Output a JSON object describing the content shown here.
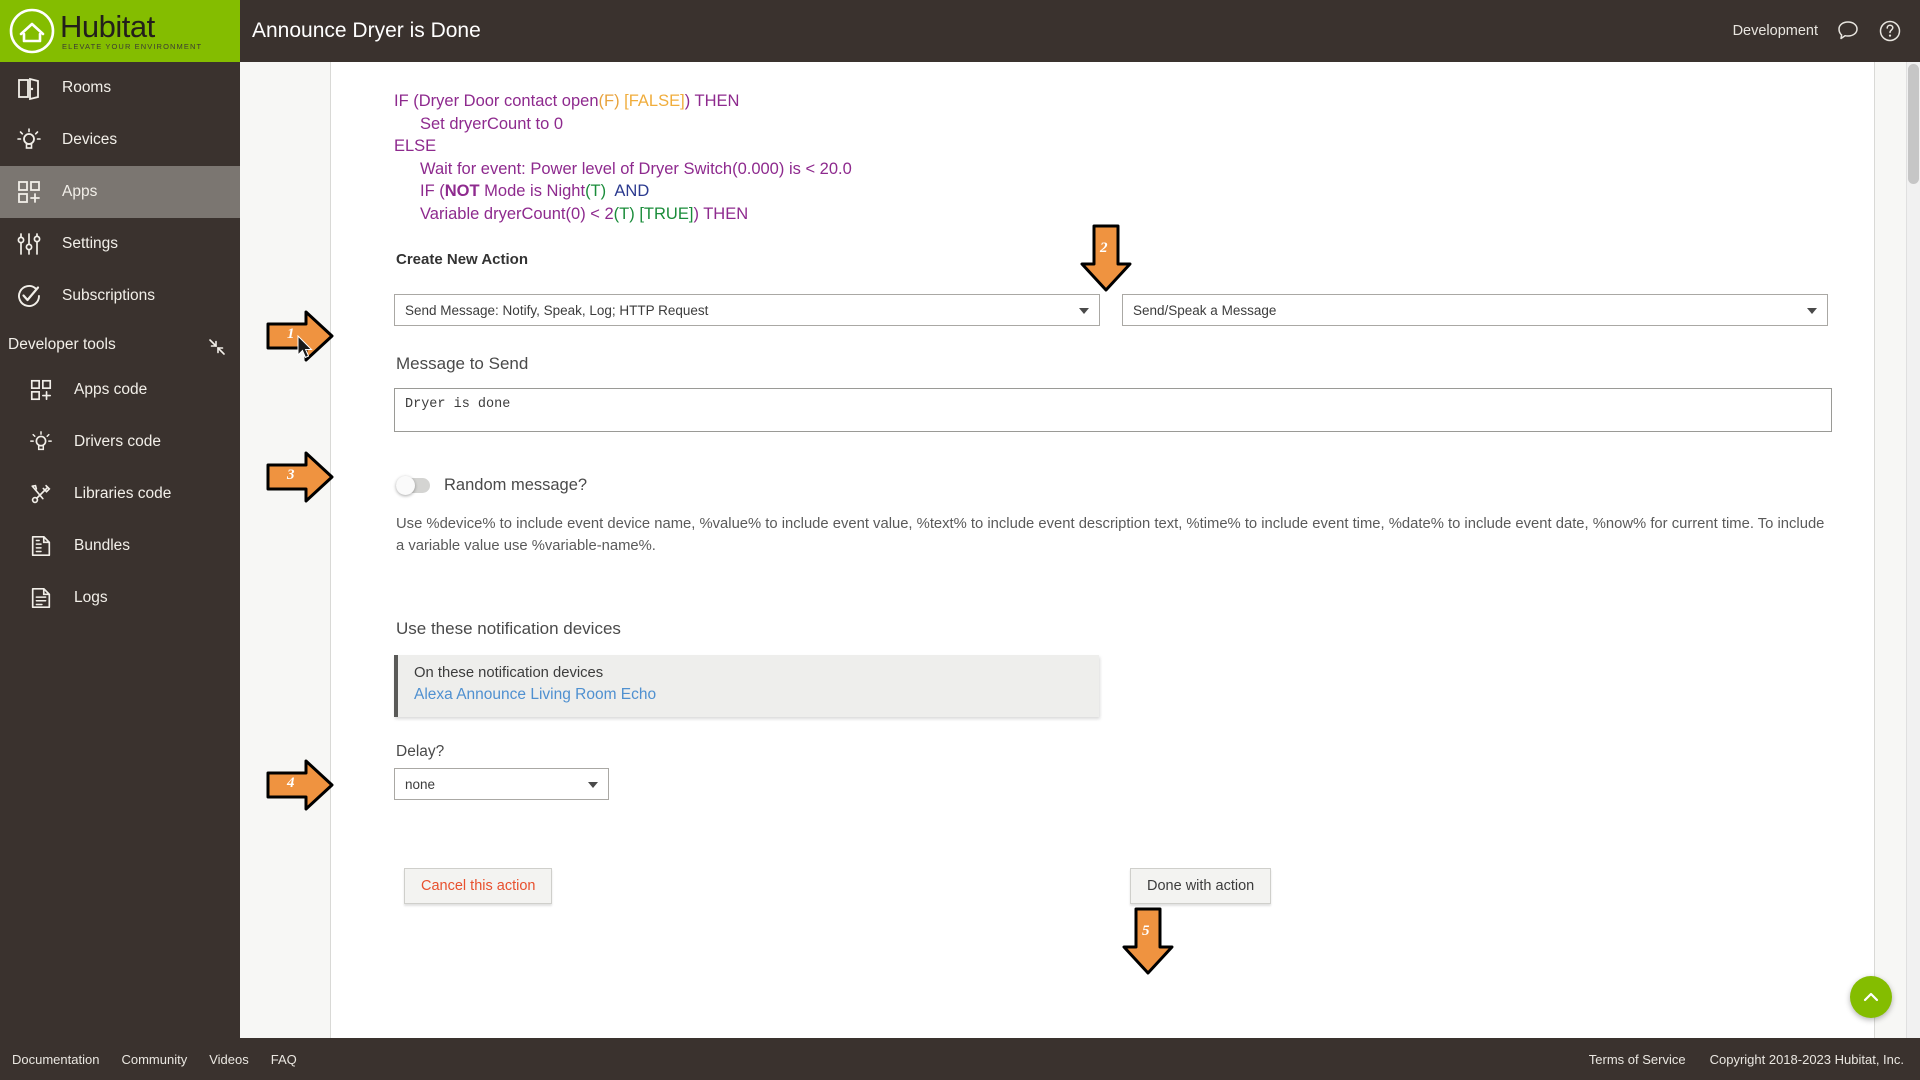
{
  "brand": {
    "name": "Hubitat",
    "tagline": "ELEVATE YOUR ENVIRONMENT",
    "green": "#84bd00",
    "dark": "#3a322e"
  },
  "sidebar": {
    "items": [
      {
        "label": "Rooms",
        "icon": "rooms-icon",
        "active": false
      },
      {
        "label": "Devices",
        "icon": "devices-icon",
        "active": false
      },
      {
        "label": "Apps",
        "icon": "apps-icon",
        "active": true
      },
      {
        "label": "Settings",
        "icon": "settings-icon",
        "active": false
      },
      {
        "label": "Subscriptions",
        "icon": "subscriptions-icon",
        "active": false
      }
    ],
    "section_label": "Developer tools",
    "dev_items": [
      {
        "label": "Apps code",
        "icon": "apps-code-icon"
      },
      {
        "label": "Drivers code",
        "icon": "drivers-code-icon"
      },
      {
        "label": "Libraries code",
        "icon": "libraries-code-icon"
      },
      {
        "label": "Bundles",
        "icon": "bundles-icon"
      },
      {
        "label": "Logs",
        "icon": "logs-icon"
      }
    ]
  },
  "header": {
    "title": "Announce Dryer is Done",
    "mode_label": "Development",
    "icons": [
      "chat-icon",
      "help-icon"
    ]
  },
  "rule": {
    "lines": [
      {
        "indent": 0,
        "parts": [
          {
            "t": "IF (Dryer Door contact open",
            "c": "purple"
          },
          {
            "t": "(F)",
            "c": "orange"
          },
          {
            "t": " ",
            "c": "purple"
          },
          {
            "t": "[FALSE]",
            "c": "orangeb"
          },
          {
            "t": ") THEN",
            "c": "purple"
          }
        ]
      },
      {
        "indent": 1,
        "parts": [
          {
            "t": "Set dryerCount to 0",
            "c": "purple"
          }
        ]
      },
      {
        "indent": 0,
        "parts": [
          {
            "t": "ELSE",
            "c": "purple"
          }
        ]
      },
      {
        "indent": 1,
        "parts": [
          {
            "t": "Wait for event: Power level of Dryer Switch(0.000) is < 20.0",
            "c": "purple"
          }
        ]
      },
      {
        "indent": 1,
        "parts": [
          {
            "t": "IF (",
            "c": "purple"
          },
          {
            "t": "NOT",
            "c": "purple bold"
          },
          {
            "t": " Mode is Night",
            "c": "purple"
          },
          {
            "t": "(T)",
            "c": "green"
          },
          {
            "t": "  ",
            "c": "purple"
          },
          {
            "t": "AND",
            "c": "navyblue"
          }
        ]
      },
      {
        "indent": 1,
        "parts": [
          {
            "t": "Variable dryerCount(0) < 2",
            "c": "purple"
          },
          {
            "t": "(T)",
            "c": "green"
          },
          {
            "t": " ",
            "c": "purple"
          },
          {
            "t": "[TRUE]",
            "c": "green"
          },
          {
            "t": ") THEN",
            "c": "purple"
          }
        ]
      }
    ]
  },
  "main": {
    "create_new_action": "Create New Action",
    "action_type_value": "Send Message: Notify, Speak, Log; HTTP Request",
    "message_type_value": "Send/Speak a Message",
    "message_to_send_label": "Message to Send",
    "message_text": "Dryer is done",
    "random_message_label": "Random message?",
    "random_message_on": false,
    "help_line1": "Use %device% to include event device name, %value% to include event value, %text% to include event description text, %time% to include event time, %date% to include event date, %now% for current time.",
    "help_line2": "To include a variable value use %variable-name%.",
    "notification_heading": "Use these notification devices",
    "notification_box_title": "On these notification devices",
    "notification_device": "Alexa Announce Living Room Echo",
    "delay_label": "Delay?",
    "delay_value": "none",
    "cancel_button": "Cancel this action",
    "done_button": "Done with action"
  },
  "annotations": [
    {
      "id": "1",
      "number": "1",
      "dir": "right",
      "target": "action-type-select"
    },
    {
      "id": "2",
      "number": "2",
      "dir": "down",
      "target": "message-type-select"
    },
    {
      "id": "3",
      "number": "3",
      "dir": "right",
      "target": "message-textarea"
    },
    {
      "id": "4",
      "number": "4",
      "dir": "right",
      "target": "notification-devices-box"
    },
    {
      "id": "5",
      "number": "5",
      "dir": "down",
      "target": "done-action-button"
    }
  ],
  "footer": {
    "links": [
      "Documentation",
      "Community",
      "Videos",
      "FAQ"
    ],
    "terms": "Terms of Service",
    "copyright": "Copyright 2018-2023 Hubitat, Inc."
  }
}
